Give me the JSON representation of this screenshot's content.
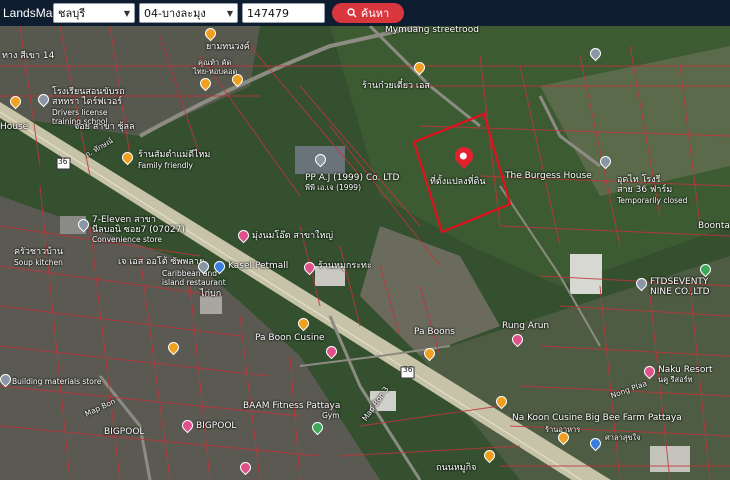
{
  "app": {
    "brand": "LandsMaps"
  },
  "toolbar": {
    "province": "ชลบุรี",
    "district": "04-บางละมุง",
    "parcel_number": "147479",
    "search_label": "ค้นหา"
  },
  "map_labels": {
    "top_left": "ทาง สีเขา 14",
    "street_view": "Mymuang streetrood",
    "shop_top": "ยามทนวงค์",
    "coffee": "คุณท้า คัด",
    "thai_shop": "ไทย-หอบคอด",
    "drivers_school_th": "โรงเรียนสอนขับรถ",
    "drivers_school_th2": "สหทรา ไดร์ฟเวอร์",
    "drivers_school_en": "Drivers license",
    "drivers_school_en2": "training school",
    "jo_shop": "จอย สาขา ชุ้ลล",
    "house": "House",
    "family_cafe": "ร้านสัมตำแม่ดีไหม",
    "family_friendly": "Family friendly",
    "road_name": "ถ. ทักษณ์",
    "pp_company": "PP A.J (1999) Co. LTD",
    "pp_company_th": "พีพี เอ.เจ (1999)",
    "shop_noodle": "ร้านก๋วยเตี๋ยว เอส",
    "parcel_label": "ที่ตั้งแปลงที่ดิน",
    "burgess": "The Burgess House",
    "temp_closed_th": "อุดไท โรงรี",
    "temp_closed_th2": "สาย 36 ฟาร์ม",
    "temp_closed": "Temporarily closed",
    "boonta": "Boonta",
    "seven_eleven": "7-Eleven สาขา",
    "seven_eleven2": "นีลบอนิ ซอย7 (07027)",
    "convenience": "Convenience store",
    "kitchen": "ครัวชาวบ้าน",
    "soup_kitchen": "Soup kitchen",
    "caribbean": "เจ เอส ออโต้ ซัพพลาย",
    "caribbean2": "Caribbean and",
    "caribbean3": "island restaurant",
    "kasel": "Kasel Petmall",
    "mungnon": "มุ่งนมโอ๊ต สาขาใหญ่",
    "mokpoo": "ร้านหมูกระทะ",
    "kaibok": "ไก่บก",
    "building_store": "Building materials store",
    "pa_boon_cusine": "Pa Boon Cusine",
    "pa_boons": "Pa Boons",
    "rung_arun": "Rung Arun",
    "ftd": "FTDSEVENTY",
    "ftd2": "NINE CO.,LTD",
    "baam": "BAAM Fitness Pattaya",
    "gym": "Gym",
    "bigpool": "BIGPOOL",
    "bigpool2": "BIGPOOL",
    "naku": "Naku Resort",
    "naku_th": "นคู รีสอร์ท",
    "nakoon": "Na Koon Cusine Big Bee Farm Pattaya",
    "nakoon_th": "ร้านอาหาร",
    "nakoon_th2": "ศาลาสุขใจ",
    "pattaya_road": "ถนนหมูกิจ",
    "map_bon": "Map Bon",
    "map_bon2": "Map Bon 3",
    "nong_plaa": "Nong Plaa",
    "sign_36": "36",
    "sign_36b": "36"
  }
}
